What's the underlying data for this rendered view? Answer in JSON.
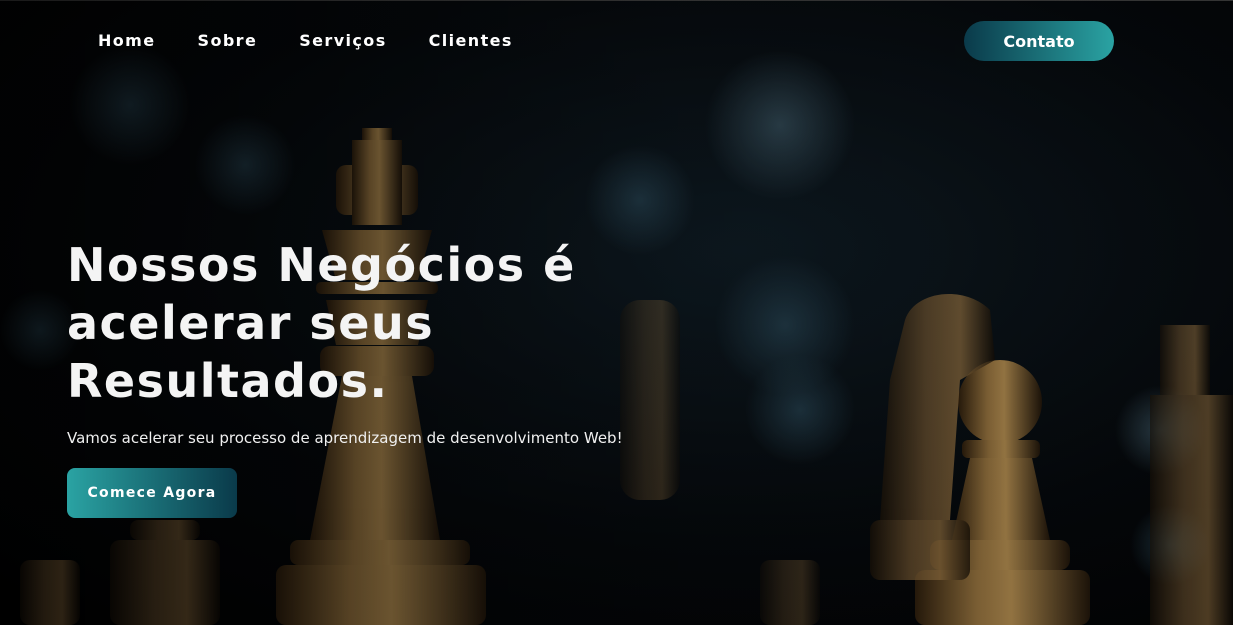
{
  "nav": {
    "items": [
      {
        "label": "Home"
      },
      {
        "label": "Sobre"
      },
      {
        "label": "Serviços"
      },
      {
        "label": "Clientes"
      }
    ],
    "contact_label": "Contato"
  },
  "hero": {
    "headline": "Nossos Negócios é acelerar seus Resultados.",
    "subtitle": "Vamos acelerar seu processo de aprendizagem de desenvolvimento Web!",
    "cta_label": "Comece Agora",
    "background_image": "chess-pieces-dark-bokeh"
  },
  "colors": {
    "accent_teal": "#2aa3a3",
    "accent_dark": "#0a3a4a",
    "background": "#000000",
    "text": "#ffffff"
  }
}
